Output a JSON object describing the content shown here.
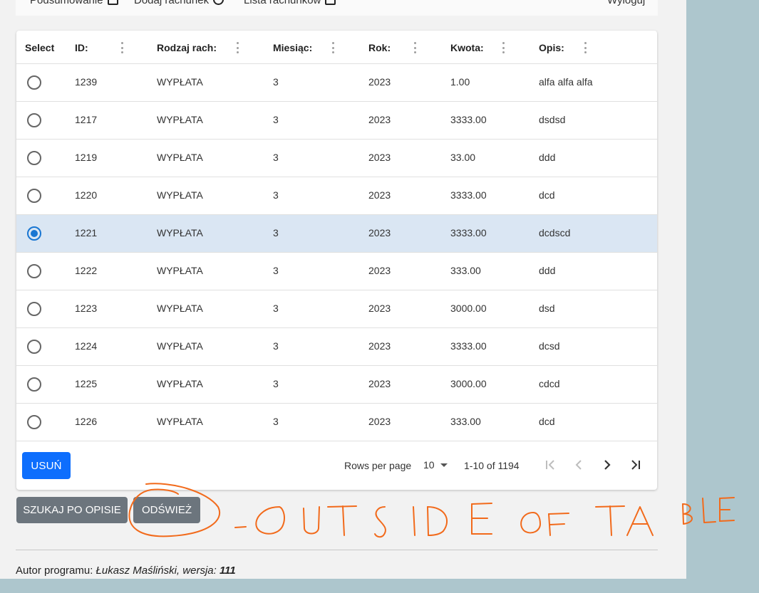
{
  "nav": {
    "item1": "Podsumowanie",
    "item2": "Dodaj rachunek",
    "item3": "Lista rachunków",
    "logout": "Wyloguj"
  },
  "table": {
    "headers": {
      "select": "Select",
      "id": "ID:",
      "type": "Rodzaj rach:",
      "month": "Miesiąc:",
      "year": "Rok:",
      "amount": "Kwota:",
      "desc": "Opis:"
    },
    "rows": [
      {
        "id": "1239",
        "type": "WYPŁATA",
        "month": "3",
        "year": "2023",
        "amount": "1.00",
        "desc": "alfa alfa alfa",
        "selected": false
      },
      {
        "id": "1217",
        "type": "WYPŁATA",
        "month": "3",
        "year": "2023",
        "amount": "3333.00",
        "desc": "dsdsd",
        "selected": false
      },
      {
        "id": "1219",
        "type": "WYPŁATA",
        "month": "3",
        "year": "2023",
        "amount": "33.00",
        "desc": "ddd",
        "selected": false
      },
      {
        "id": "1220",
        "type": "WYPŁATA",
        "month": "3",
        "year": "2023",
        "amount": "3333.00",
        "desc": "dcd",
        "selected": false
      },
      {
        "id": "1221",
        "type": "WYPŁATA",
        "month": "3",
        "year": "2023",
        "amount": "3333.00",
        "desc": "dcdscd",
        "selected": true
      },
      {
        "id": "1222",
        "type": "WYPŁATA",
        "month": "3",
        "year": "2023",
        "amount": "333.00",
        "desc": "ddd",
        "selected": false
      },
      {
        "id": "1223",
        "type": "WYPŁATA",
        "month": "3",
        "year": "2023",
        "amount": "3000.00",
        "desc": "dsd",
        "selected": false
      },
      {
        "id": "1224",
        "type": "WYPŁATA",
        "month": "3",
        "year": "2023",
        "amount": "3333.00",
        "desc": "dcsd",
        "selected": false
      },
      {
        "id": "1225",
        "type": "WYPŁATA",
        "month": "3",
        "year": "2023",
        "amount": "3000.00",
        "desc": "cdcd",
        "selected": false
      },
      {
        "id": "1226",
        "type": "WYPŁATA",
        "month": "3",
        "year": "2023",
        "amount": "333.00",
        "desc": "dcd",
        "selected": false
      }
    ]
  },
  "footer": {
    "delete_label": "USUŃ",
    "rows_per_page_label": "Rows per page",
    "rows_per_page_value": "10",
    "range_text": "1-10 of 1194"
  },
  "actions": {
    "search_label": "SZUKAJ PO OPISIE",
    "refresh_label": "ODŚWIEŻ"
  },
  "annotation_text": "-OUTSIDE OF TABLE",
  "author": {
    "prefix": "Autor programu:",
    "name": "Łukasz Maśliński, wersja:",
    "version": "111"
  },
  "colors": {
    "primary": "#0d6efd",
    "secondary": "#6c757d",
    "selected_row": "#dae6f3",
    "radio_checked": "#1976d2",
    "annotation": "#f26a1b"
  }
}
